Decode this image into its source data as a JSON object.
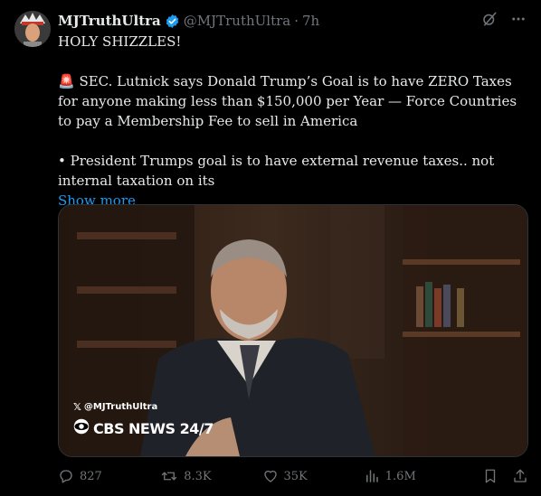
{
  "post": {
    "author_name": "MJTruthUltra",
    "author_handle": "@MJTruthUltra",
    "separator": "·",
    "time": "7h",
    "text_line1": "HOLY SHIZZLES!",
    "text_paragraph2": "🚨 SEC. Lutnick says Donald Trump’s Goal is to have ZERO Taxes for anyone making less than $150,000 per Year — Force Countries to pay a Membership Fee to sell in America",
    "text_paragraph3": "• President Trumps goal is to have external revenue taxes.. not internal taxation on its",
    "show_more": "Show more"
  },
  "media": {
    "watermark_handle": "@MJTruthUltra",
    "network_label": "CBS NEWS 24/7"
  },
  "actions": {
    "replies": "827",
    "reposts": "8.3K",
    "likes": "35K",
    "views": "1.6M"
  },
  "icons": {
    "verified": "verified-badge-icon",
    "grok": "grok-icon",
    "more": "more-icon",
    "reply": "reply-icon",
    "repost": "repost-icon",
    "like": "heart-icon",
    "views": "views-icon",
    "bookmark": "bookmark-icon",
    "share": "share-icon"
  },
  "colors": {
    "background": "#000000",
    "text": "#e7e9ea",
    "secondary": "#71767b",
    "link": "#1d9bf0",
    "verified": "#1d9bf0"
  }
}
